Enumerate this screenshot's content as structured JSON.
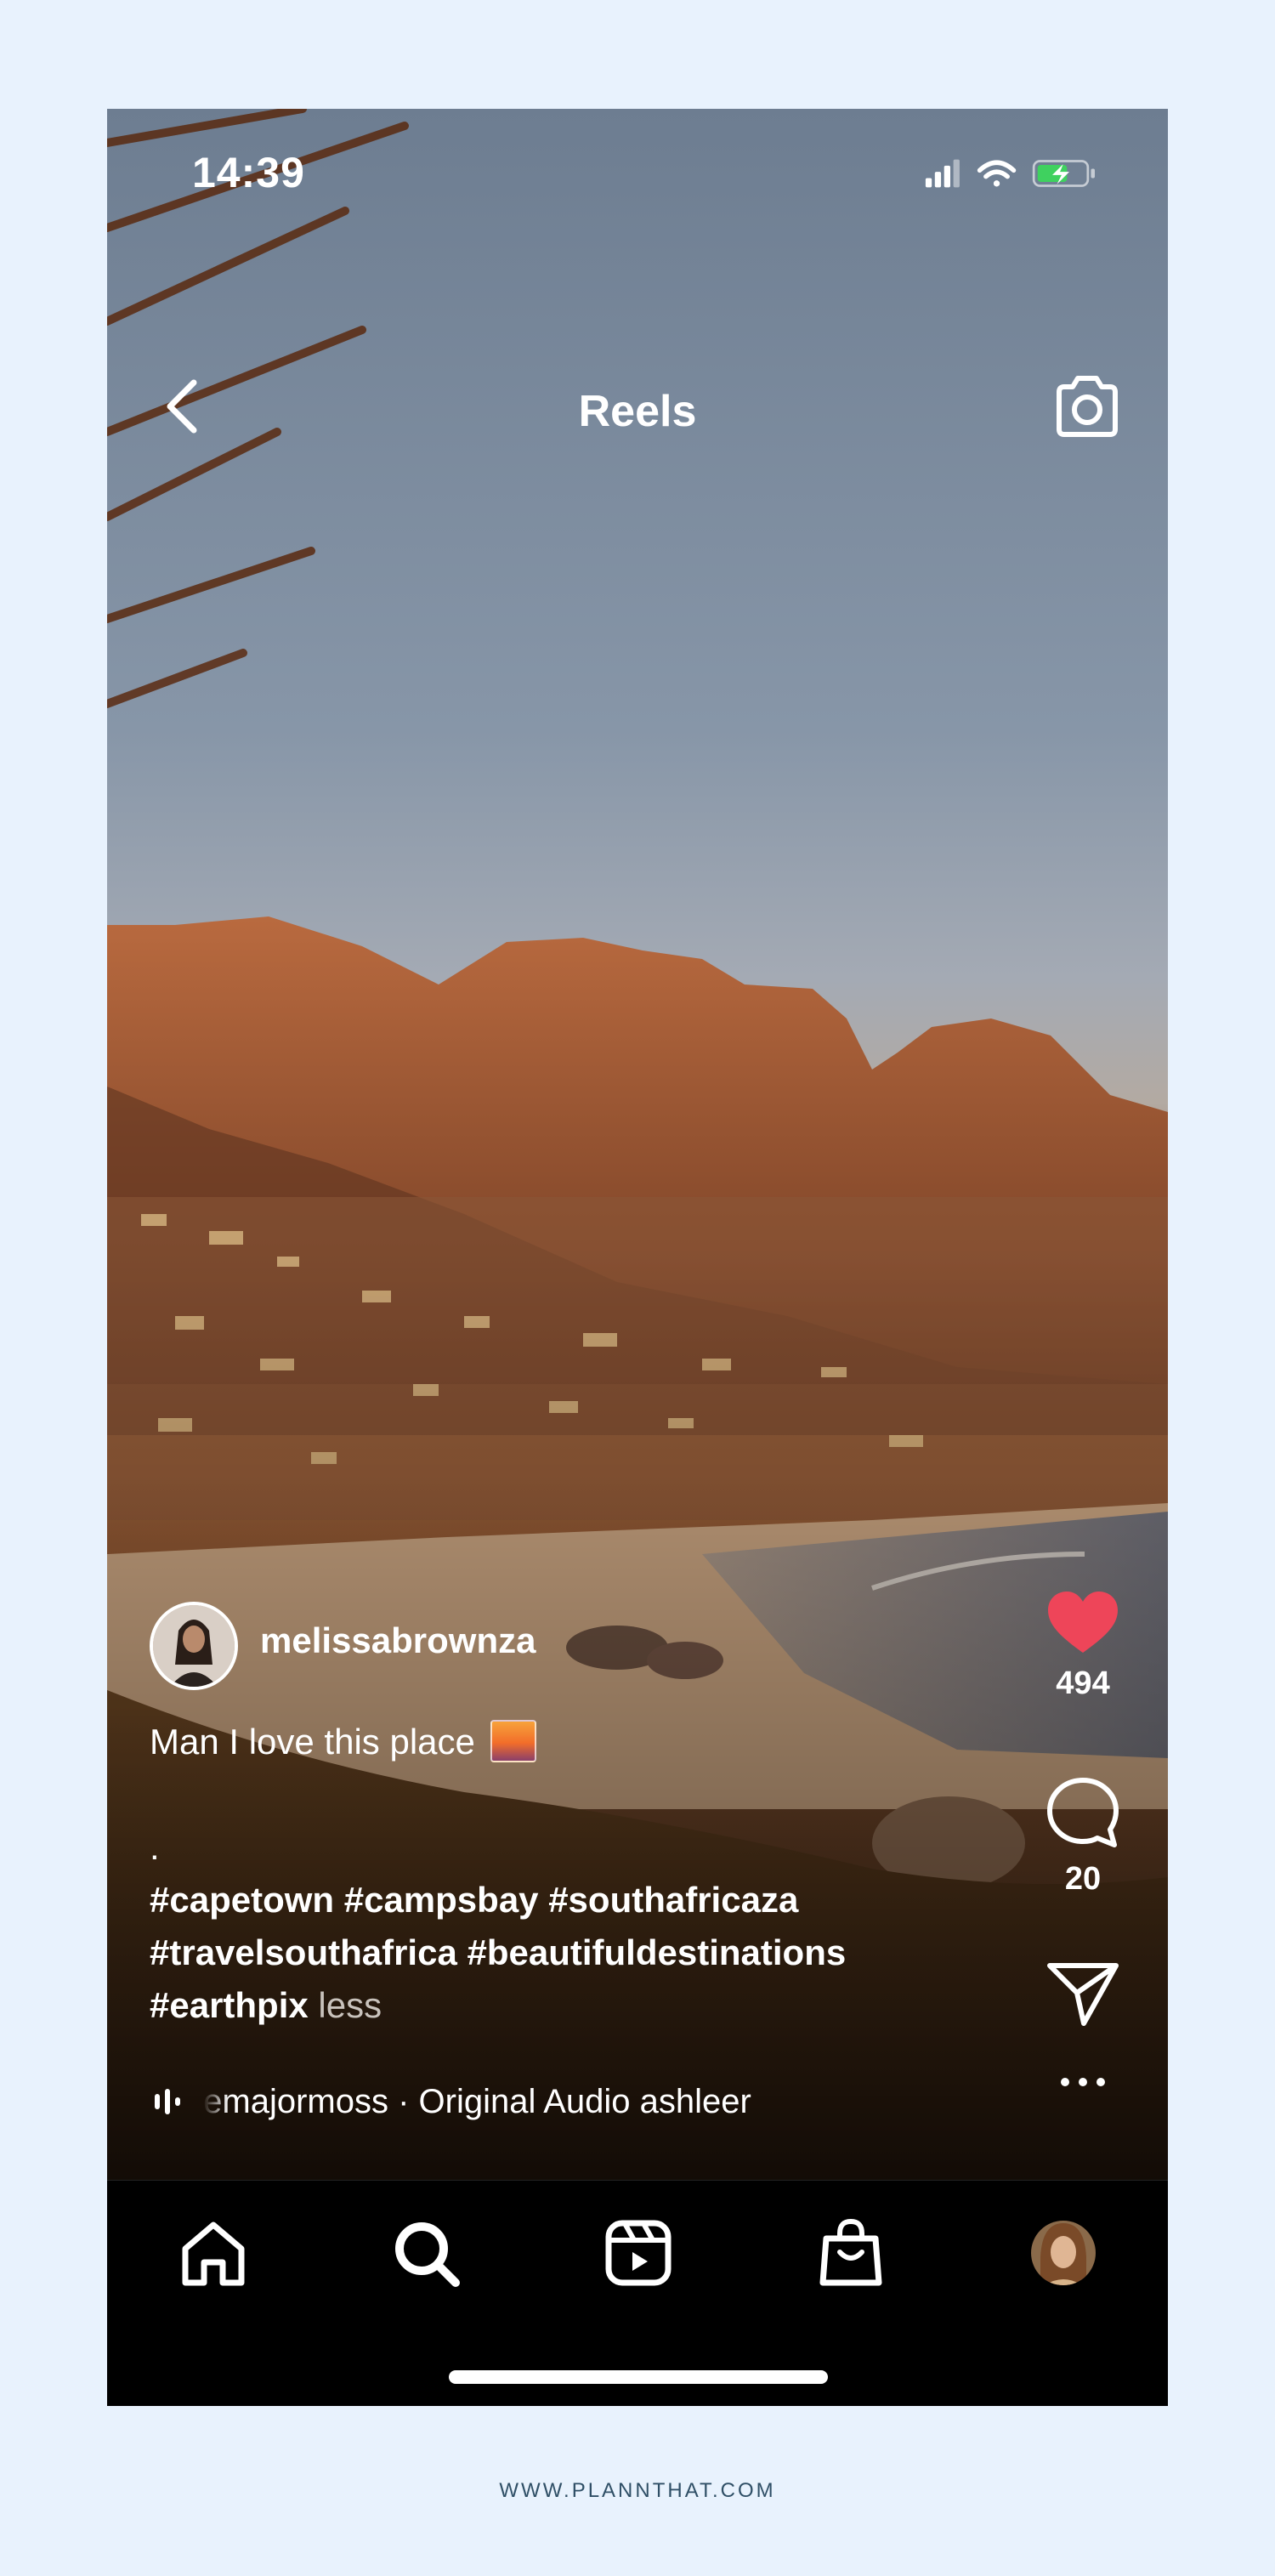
{
  "status_bar": {
    "time": "14:39"
  },
  "header": {
    "title": "Reels"
  },
  "post": {
    "author": "melissabrownza",
    "caption_line": "Man I love this place",
    "caption_dot": ".",
    "hashtags_line1": "#capetown #campsbay #southafricaza",
    "hashtags_line2": "#travelsouthafrica #beautifuldestinations",
    "hashtags_line3": "#earthpix",
    "less_label": "less",
    "audio_text": "emajormoss · Original Audio   ashleer"
  },
  "actions": {
    "like_count": "494",
    "comment_count": "20"
  },
  "colors": {
    "like": "#ee4559",
    "page_bg": "#e8f2fd"
  },
  "footer": {
    "text": "WWW.PLANNTHAT.COM"
  }
}
